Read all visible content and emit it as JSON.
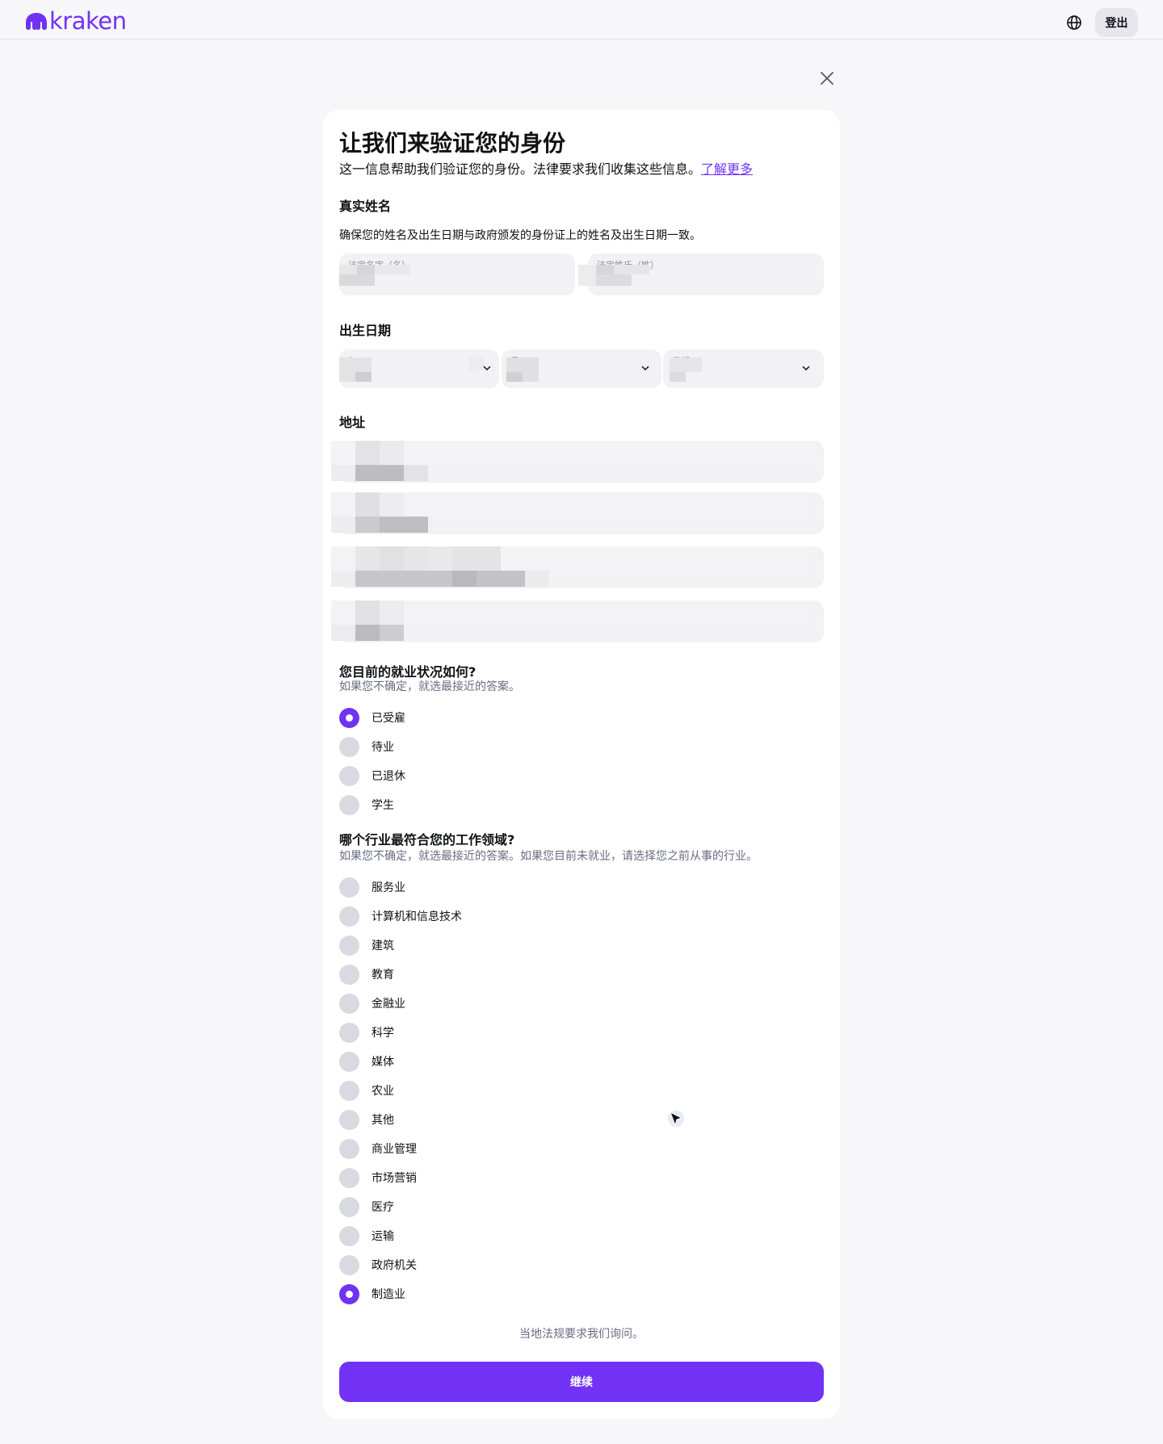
{
  "header": {
    "logo_text": "kraken",
    "brand_color": "#7132f5",
    "globe_icon": "globe-icon",
    "logout_label": "登出"
  },
  "close_icon": "close-icon",
  "form": {
    "title": "让我们来验证您的身份",
    "subtitle": "这一信息帮助我们验证您的身份。法律要求我们收集这些信息。",
    "learn_more": "了解更多",
    "legal_name": {
      "heading": "真实姓名",
      "hint": "确保您的姓名及出生日期与政府颁发的身份证上的姓名及出生日期一致。",
      "first_placeholder": "法定名字（名）",
      "last_placeholder": "法定姓氏（姓）"
    },
    "dob": {
      "heading": "出生日期",
      "year_placeholder": "年",
      "month_placeholder": "月",
      "day_placeholder": "日期"
    },
    "address": {
      "heading": "地址"
    },
    "employment": {
      "question": "您目前的就业状况如何?",
      "hint": "如果您不确定，就选最接近的答案。",
      "options": [
        {
          "label": "已受雇",
          "selected": true
        },
        {
          "label": "待业",
          "selected": false
        },
        {
          "label": "已退休",
          "selected": false
        },
        {
          "label": "学生",
          "selected": false
        }
      ]
    },
    "industry": {
      "question": "哪个行业最符合您的工作领域?",
      "hint": "如果您不确定，就选最接近的答案。如果您目前未就业，请选择您之前从事的行业。",
      "options": [
        {
          "label": "服务业",
          "selected": false
        },
        {
          "label": "计算机和信息技术",
          "selected": false
        },
        {
          "label": "建筑",
          "selected": false
        },
        {
          "label": "教育",
          "selected": false
        },
        {
          "label": "金融业",
          "selected": false
        },
        {
          "label": "科学",
          "selected": false
        },
        {
          "label": "媒体",
          "selected": false
        },
        {
          "label": "农业",
          "selected": false
        },
        {
          "label": "其他",
          "selected": false
        },
        {
          "label": "商业管理",
          "selected": false
        },
        {
          "label": "市场营销",
          "selected": false
        },
        {
          "label": "医疗",
          "selected": false
        },
        {
          "label": "运输",
          "selected": false
        },
        {
          "label": "政府机关",
          "selected": false
        },
        {
          "label": "制造业",
          "selected": true
        }
      ]
    },
    "legal_note": "当地法规要求我们询问。",
    "continue_label": "继续"
  }
}
